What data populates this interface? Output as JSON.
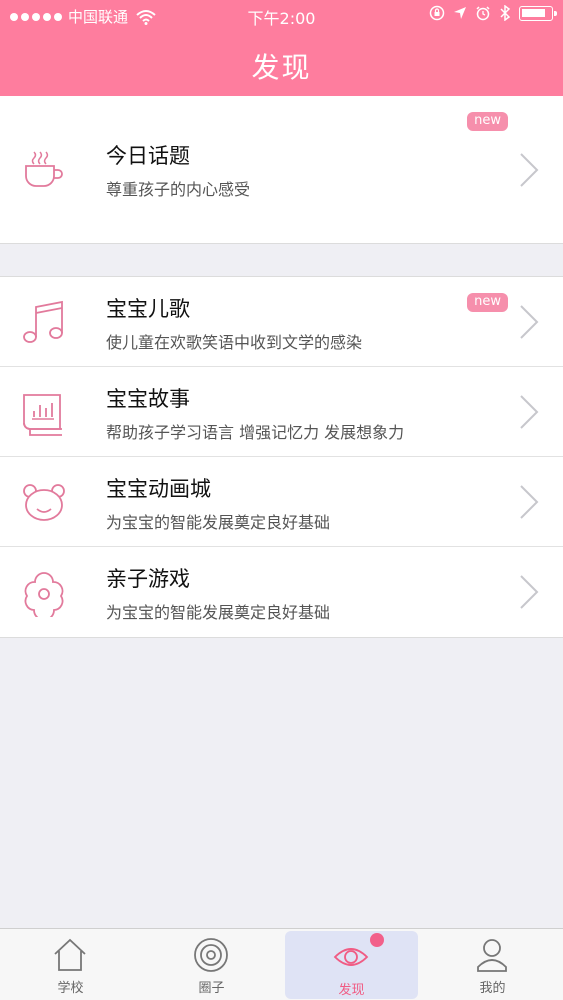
{
  "status_bar": {
    "carrier": "中国联通",
    "time": "下午2:00",
    "battery_level": 0.85
  },
  "header": {
    "title": "发现"
  },
  "sections": [
    {
      "items": [
        {
          "title": "今日话题",
          "subtitle": "尊重孩子的内心感受",
          "badge": "new",
          "icon": "coffee-cup-icon"
        }
      ]
    },
    {
      "items": [
        {
          "title": "宝宝儿歌",
          "subtitle": "使儿童在欢歌笑语中收到文学的感染",
          "badge": "new",
          "icon": "music-note-icon"
        },
        {
          "title": "宝宝故事",
          "subtitle": "帮助孩子学习语言 增强记忆力 发展想象力",
          "icon": "book-icon"
        },
        {
          "title": "宝宝动画城",
          "subtitle": "为宝宝的智能发展奠定良好基础",
          "icon": "bear-face-icon"
        },
        {
          "title": "亲子游戏",
          "subtitle": "为宝宝的智能发展奠定良好基础",
          "icon": "flower-icon"
        }
      ]
    }
  ],
  "tabbar": {
    "tabs": [
      {
        "label": "学校",
        "icon": "home-icon"
      },
      {
        "label": "圈子",
        "icon": "circles-icon"
      },
      {
        "label": "发现",
        "icon": "eye-icon",
        "active": true,
        "has_dot": true
      },
      {
        "label": "我的",
        "icon": "person-icon"
      }
    ]
  },
  "colors": {
    "accent": "#fe7d9e",
    "badge": "#f68fac",
    "icon_stroke": "#e27a9c",
    "active_tab_bg": "#dfe3f5"
  }
}
